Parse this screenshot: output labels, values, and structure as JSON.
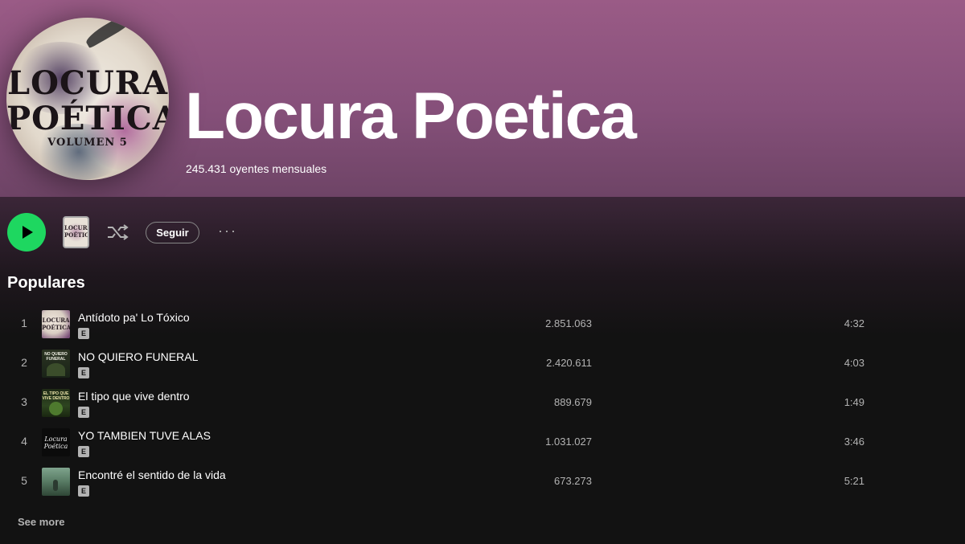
{
  "artist": {
    "name": "Locura Poetica",
    "monthly_listeners": "245.431 oyentes mensuales",
    "avatar_text": {
      "line1": "LOCURA",
      "line2": "POÉTICA",
      "line3": "VOLUMEN 5"
    }
  },
  "actions": {
    "play_icon": "play-icon",
    "mini_cover_text": "LOCURA POÉTICA",
    "shuffle_icon": "shuffle-icon",
    "follow_label": "Seguir",
    "more_label": "···"
  },
  "popular": {
    "title": "Populares",
    "tracks": [
      {
        "number": "1",
        "title": "Antídoto pa' Lo Tóxico",
        "explicit": "E",
        "plays": "2.851.063",
        "duration": "4:32",
        "cover_text": "LOCURA POÉTICA"
      },
      {
        "number": "2",
        "title": "NO QUIERO FUNERAL",
        "explicit": "E",
        "plays": "2.420.611",
        "duration": "4:03",
        "cover_text": "NO QUIERO FUNERAL"
      },
      {
        "number": "3",
        "title": "El tipo que vive dentro",
        "explicit": "E",
        "plays": "889.679",
        "duration": "1:49",
        "cover_text": "EL TIPO QUE VIVE DENTRO"
      },
      {
        "number": "4",
        "title": "YO TAMBIEN TUVE ALAS",
        "explicit": "E",
        "plays": "1.031.027",
        "duration": "3:46",
        "cover_text": "Locura Poética"
      },
      {
        "number": "5",
        "title": "Encontré el sentido de la vida",
        "explicit": "E",
        "plays": "673.273",
        "duration": "5:21",
        "cover_text": ""
      }
    ],
    "see_more": "See more"
  },
  "colors": {
    "accent": "#1ed760",
    "header_top": "#9a5b86",
    "background": "#121212",
    "secondary_text": "#b3b3b3"
  }
}
